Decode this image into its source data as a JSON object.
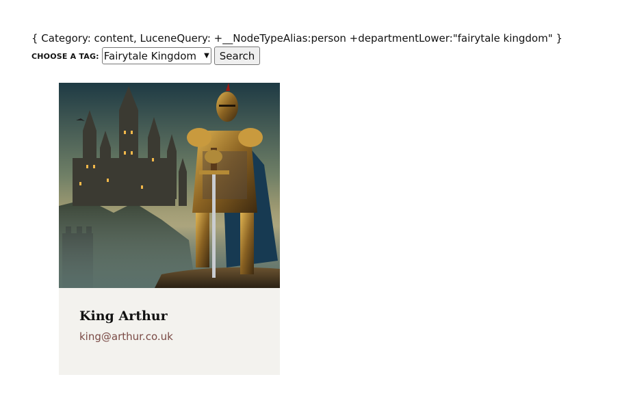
{
  "query": {
    "text": "{ Category: content, LuceneQuery: +__NodeTypeAlias:person +departmentLower:\"fairytale kingdom\" }"
  },
  "filter": {
    "label": "CHOOSE A TAG:",
    "selected": "Fairytale Kingdom",
    "button_label": "Search"
  },
  "results": [
    {
      "name": "King Arthur",
      "email": "king@arthur.co.uk",
      "image_icon": "knight-castle-image"
    }
  ]
}
